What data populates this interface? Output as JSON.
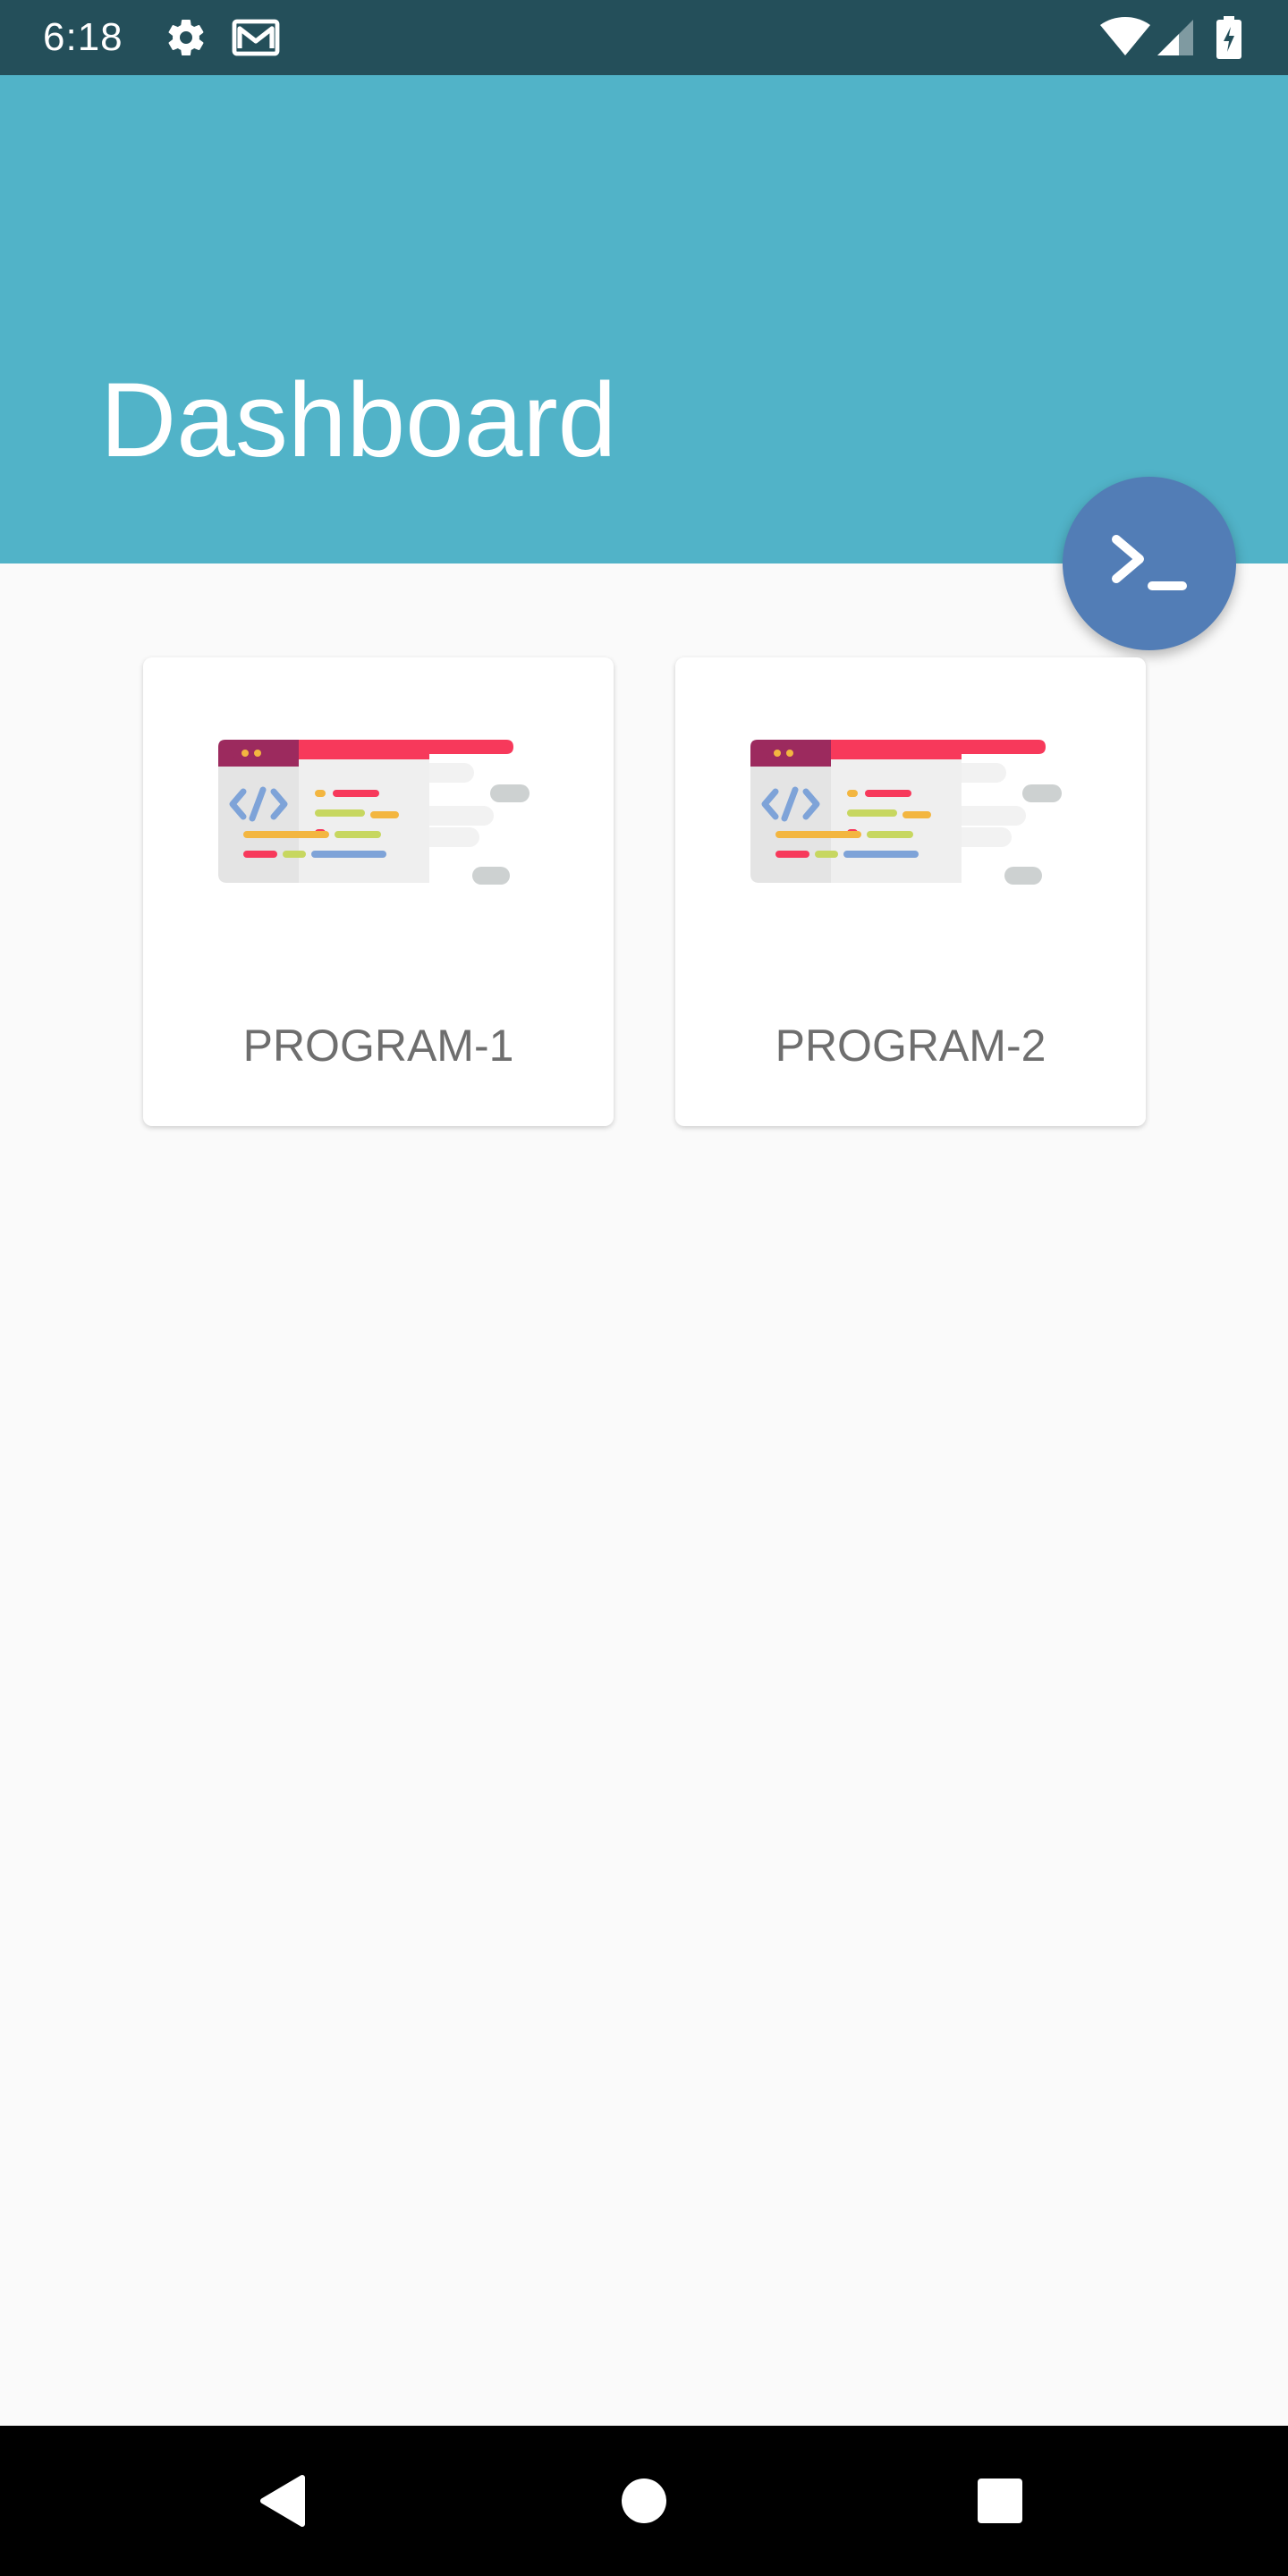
{
  "status_bar": {
    "time": "6:18",
    "icons": [
      "gear-icon",
      "gmail-icon",
      "wifi-icon",
      "signal-icon",
      "battery-charging-icon"
    ]
  },
  "header": {
    "title": "Dashboard",
    "background_color": "#51b3c8"
  },
  "fab": {
    "icon": "terminal-icon",
    "color": "#527db6"
  },
  "programs": [
    {
      "label": "PROGRAM-1",
      "icon": "code-window-icon"
    },
    {
      "label": "PROGRAM-2",
      "icon": "code-window-icon"
    }
  ],
  "nav_bar": {
    "buttons": [
      "back-icon",
      "home-icon",
      "recents-icon"
    ]
  },
  "colors": {
    "status_bar": "#244f5a",
    "background": "#fafafa",
    "accent_red": "#f7395b",
    "accent_blue": "#7ea3d8"
  }
}
